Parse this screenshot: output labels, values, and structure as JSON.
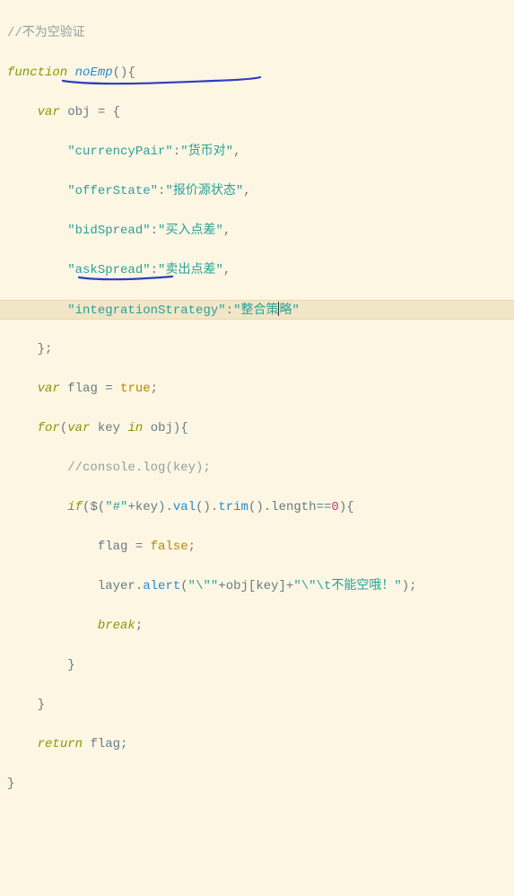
{
  "code": {
    "comment_top": "//不为空验证",
    "fn_kw": "function",
    "fn_name": "noEmp",
    "var_kw": "var",
    "obj_name": "obj",
    "pairs": [
      {
        "key": "\"currencyPair\"",
        "val": "\"货币对\""
      },
      {
        "key": "\"offerState\"",
        "val": "\"报价源状态\""
      },
      {
        "key": "\"bidSpread\"",
        "val": "\"买入点差\""
      },
      {
        "key": "\"askSpread\"",
        "val": "\"卖出点差\""
      },
      {
        "key": "\"integrationStrategy\"",
        "val": "\"整合策略\""
      }
    ],
    "flag_name": "flag",
    "flag_val": "true",
    "for_kw": "for",
    "key_name": "key",
    "in_kw": "in",
    "inner_comment": "//console.log(key);",
    "if_kw": "if",
    "jq_sel": "\"#\"",
    "val_fn": "val",
    "trim_fn": "trim",
    "length_prop": "length",
    "eq_zero": "0",
    "false_val": "false",
    "layer": "layer",
    "alert_fn": "alert",
    "alert_pre": "\"\\\"\"",
    "alert_post": "\"\\\"\\t不能空哦！\"",
    "break_kw": "break",
    "return_kw": "return"
  }
}
